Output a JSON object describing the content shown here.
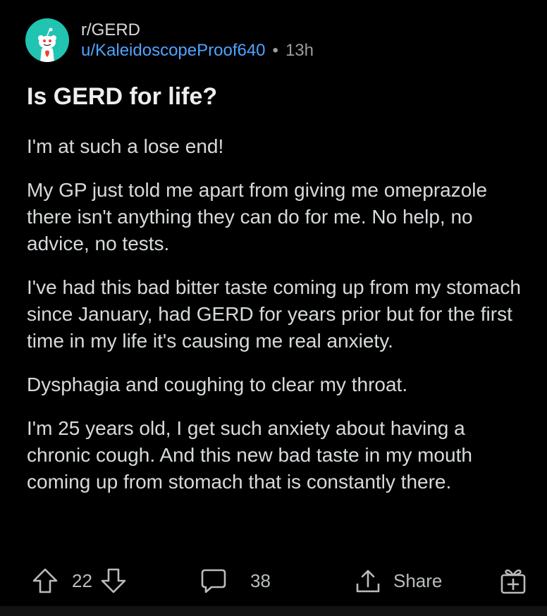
{
  "post": {
    "subreddit": "r/GERD",
    "author": "u/KaleidoscopeProof640",
    "separator": "•",
    "time": "13h",
    "title": "Is GERD for life?",
    "body": [
      "I'm at such a lose end!",
      "My GP just told me apart from giving me omeprazole there isn't anything they can do for me. No help, no advice, no tests.",
      "I've had this bad bitter taste coming up from my stomach since January, had GERD for years prior but for the first time in my life it's causing me real anxiety.",
      "Dysphagia and coughing to clear my throat.",
      "I'm 25 years old, I get such anxiety about having a chronic cough. And this new bad taste in my mouth coming up from stomach that is constantly there."
    ]
  },
  "actions": {
    "votes": "22",
    "comments": "38",
    "share": "Share"
  },
  "icons": {
    "avatar": "reddit-snoo-icon",
    "upvote": "upvote-arrow-icon",
    "downvote": "downvote-arrow-icon",
    "comment": "comment-bubble-icon",
    "share": "share-upload-icon",
    "award": "gift-award-icon"
  },
  "colors": {
    "background": "#000000",
    "avatar_bg": "#21c4b0",
    "username": "#4fa3ff"
  }
}
